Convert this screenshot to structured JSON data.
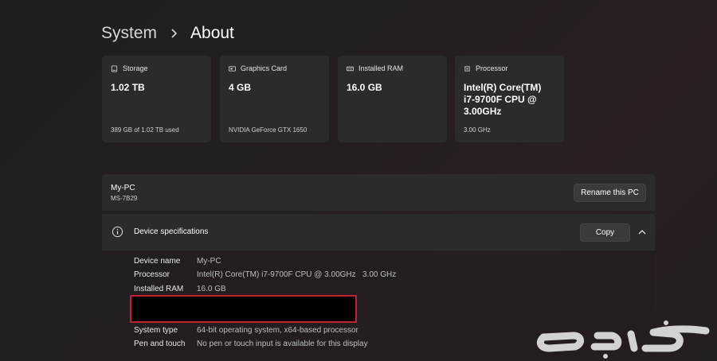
{
  "breadcrumb": {
    "parent": "System",
    "current": "About"
  },
  "cards": [
    {
      "title": "Storage",
      "icon": "storage-icon",
      "value": "1.02 TB",
      "sub": "389 GB of 1.02 TB used"
    },
    {
      "title": "Graphics Card",
      "icon": "graphics-card-icon",
      "value": "4 GB",
      "sub": "NVIDIA GeForce GTX 1650"
    },
    {
      "title": "Installed RAM",
      "icon": "ram-icon",
      "value": "16.0 GB",
      "sub": ""
    },
    {
      "title": "Processor",
      "icon": "processor-icon",
      "value": "Intel(R) Core(TM) i7-9700F CPU @ 3.00GHz",
      "sub": "3.00 GHz"
    }
  ],
  "pc": {
    "name": "My-PC",
    "model": "MS-7B29",
    "rename_label": "Rename this PC"
  },
  "specs": {
    "title": "Device specifications",
    "copy_label": "Copy",
    "rows": [
      {
        "label": "Device name",
        "value": "My-PC"
      },
      {
        "label": "Processor",
        "value": "Intel(R) Core(TM) i7-9700F CPU @ 3.00GHz   3.00 GHz"
      },
      {
        "label": "Installed RAM",
        "value": "16.0 GB"
      },
      {
        "label": "System type",
        "value": "64-bit operating system, x64-based processor"
      },
      {
        "label": "Pen and touch",
        "value": "No pen or touch input is available for this display"
      }
    ]
  },
  "watermark": {
    "text": "حراج"
  },
  "colors": {
    "card_bg": "#2b2a2c",
    "redaction_border": "#c0232e"
  }
}
